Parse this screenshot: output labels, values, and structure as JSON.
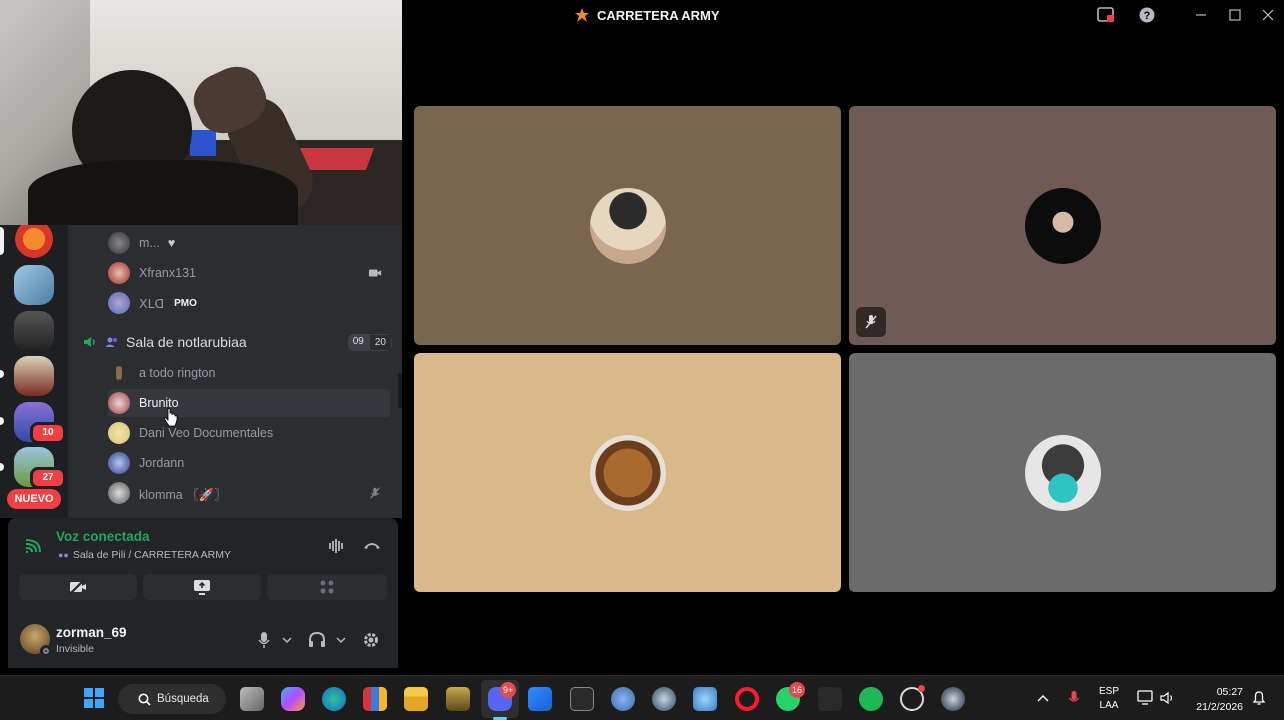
{
  "window": {
    "title": "CARRETERA ARMY"
  },
  "server_rail": {
    "badges": [
      "10",
      "27"
    ],
    "new_label": "NUEVO"
  },
  "channel_list": {
    "users_top": [
      {
        "name": "m...",
        "extra": "♥"
      },
      {
        "name": "Xfranx131",
        "icon": "video-icon"
      },
      {
        "name": "ꓫꓡꓷ",
        "tag": "PMO"
      }
    ],
    "voice_channel": {
      "name": "Sala de notlarubiaa",
      "count_current": "09",
      "count_limit": "20"
    },
    "users": [
      {
        "name": "a todo rington"
      },
      {
        "name": "Brunito"
      },
      {
        "name": "Dani Veo Documentales"
      },
      {
        "name": "Jordann"
      },
      {
        "name": "klomma 〖🚀〗",
        "icon": "mic-muted-icon"
      }
    ]
  },
  "voice_status": {
    "status": "Voz conectada",
    "location": "Sala de Pili / CARRETERA ARMY"
  },
  "user": {
    "name": "zorman_69",
    "status": "Invisible"
  },
  "tiles": [
    {
      "bg": "#7a6650"
    },
    {
      "bg": "#6f5a55",
      "muted": true
    },
    {
      "bg": "#d7b98a"
    },
    {
      "bg": "#6b6b6b"
    }
  ],
  "taskbar": {
    "search_label": "Búsqueda",
    "discord_badge": "9+",
    "whatsapp_badge": "16",
    "language": "ESP",
    "layout": "LAA",
    "time": "05:27",
    "date": "21/2/2026"
  },
  "colors": {
    "discord_green": "#23a55a",
    "discord_bg": "#2b2d31",
    "accent": "#5865f2"
  }
}
